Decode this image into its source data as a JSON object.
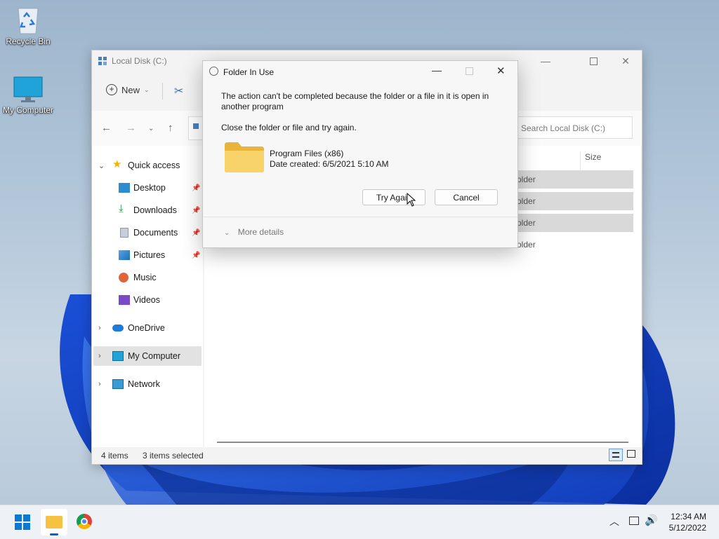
{
  "desktop": {
    "icons": [
      {
        "label": "Recycle Bin"
      },
      {
        "label": "My Computer"
      }
    ]
  },
  "explorer": {
    "title": "Local Disk (C:)",
    "toolbar": {
      "new_label": "New"
    },
    "search_placeholder": "Search Local Disk (C:)",
    "nav": [
      {
        "label": "Quick access"
      },
      {
        "label": "Desktop"
      },
      {
        "label": "Downloads"
      },
      {
        "label": "Documents"
      },
      {
        "label": "Pictures"
      },
      {
        "label": "Music"
      },
      {
        "label": "Videos"
      },
      {
        "label": "OneDrive"
      },
      {
        "label": "My Computer"
      },
      {
        "label": "Network"
      }
    ],
    "column_size": "Size",
    "rows": [
      "older",
      "older",
      "older",
      "older"
    ],
    "status": {
      "items": "4 items",
      "selected": "3 items selected"
    }
  },
  "dialog": {
    "title": "Folder In Use",
    "message": "The action can't be completed because the folder or a file in it is open in another program",
    "instruction": "Close the folder or file and try again.",
    "item_name": "Program Files (x86)",
    "item_date": "Date created: 6/5/2021 5:10 AM",
    "try_again_label": "Try Again",
    "cancel_label": "Cancel",
    "more_details_label": "More details"
  },
  "taskbar": {
    "time": "12:34 AM",
    "date": "5/12/2022"
  },
  "colors": {
    "accent": "#0067c0",
    "folder": "#f5c242",
    "selection": "#d9d9d9"
  }
}
